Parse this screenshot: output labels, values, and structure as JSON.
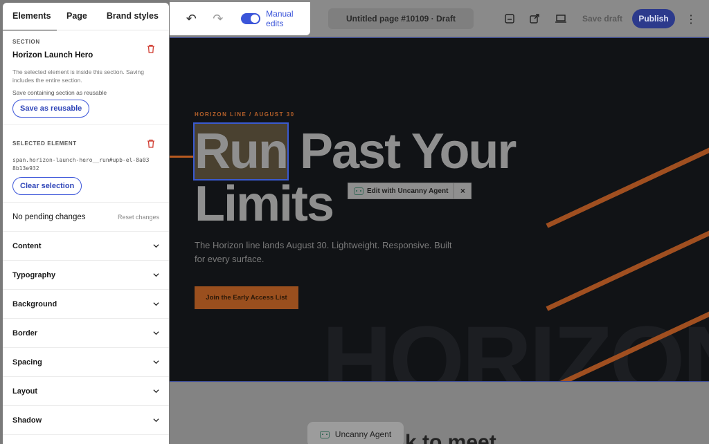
{
  "sidebar": {
    "tabs": [
      "Elements",
      "Page",
      "Brand styles"
    ],
    "section": {
      "kicker": "SECTION",
      "name": "Horizon Launch Hero",
      "description": "The selected element is inside this section. Saving includes the entire section.",
      "note": "Save containing section as reusable",
      "save_label": "Save as reusable"
    },
    "selected": {
      "kicker": "SELECTED ELEMENT",
      "selector": "span.horizon-launch-hero__run#upb-el-8a038b13e932",
      "clear_label": "Clear selection"
    },
    "pending": "No pending changes",
    "reset_label": "Reset changes",
    "panels": [
      "Content",
      "Typography",
      "Background",
      "Border",
      "Spacing",
      "Layout",
      "Shadow"
    ]
  },
  "toolbar": {
    "toggle_label": "Manual edits",
    "page_title": "Untitled page #10109 · Draft",
    "save_draft": "Save draft",
    "publish": "Publish"
  },
  "hero": {
    "eyebrow": "HORIZON LINE  /  AUGUST 30",
    "title_run": "Run",
    "title_rest": " Past Your",
    "title_line2": "Limits",
    "body": "The Horizon line lands August 30. Lightweight. Responsive. Built for every surface.",
    "cta": "Join the Early Access List",
    "bg_word": "HORIZON"
  },
  "agent": {
    "edit_label": "Edit with Uncanny Agent",
    "close": "×",
    "pill_label": "Uncanny Agent"
  },
  "below": {
    "heading_fragment": "k to meet"
  },
  "colors": {
    "accent": "#3b55d9",
    "danger": "#d03a2f",
    "hero_orange": "#a04f20"
  }
}
